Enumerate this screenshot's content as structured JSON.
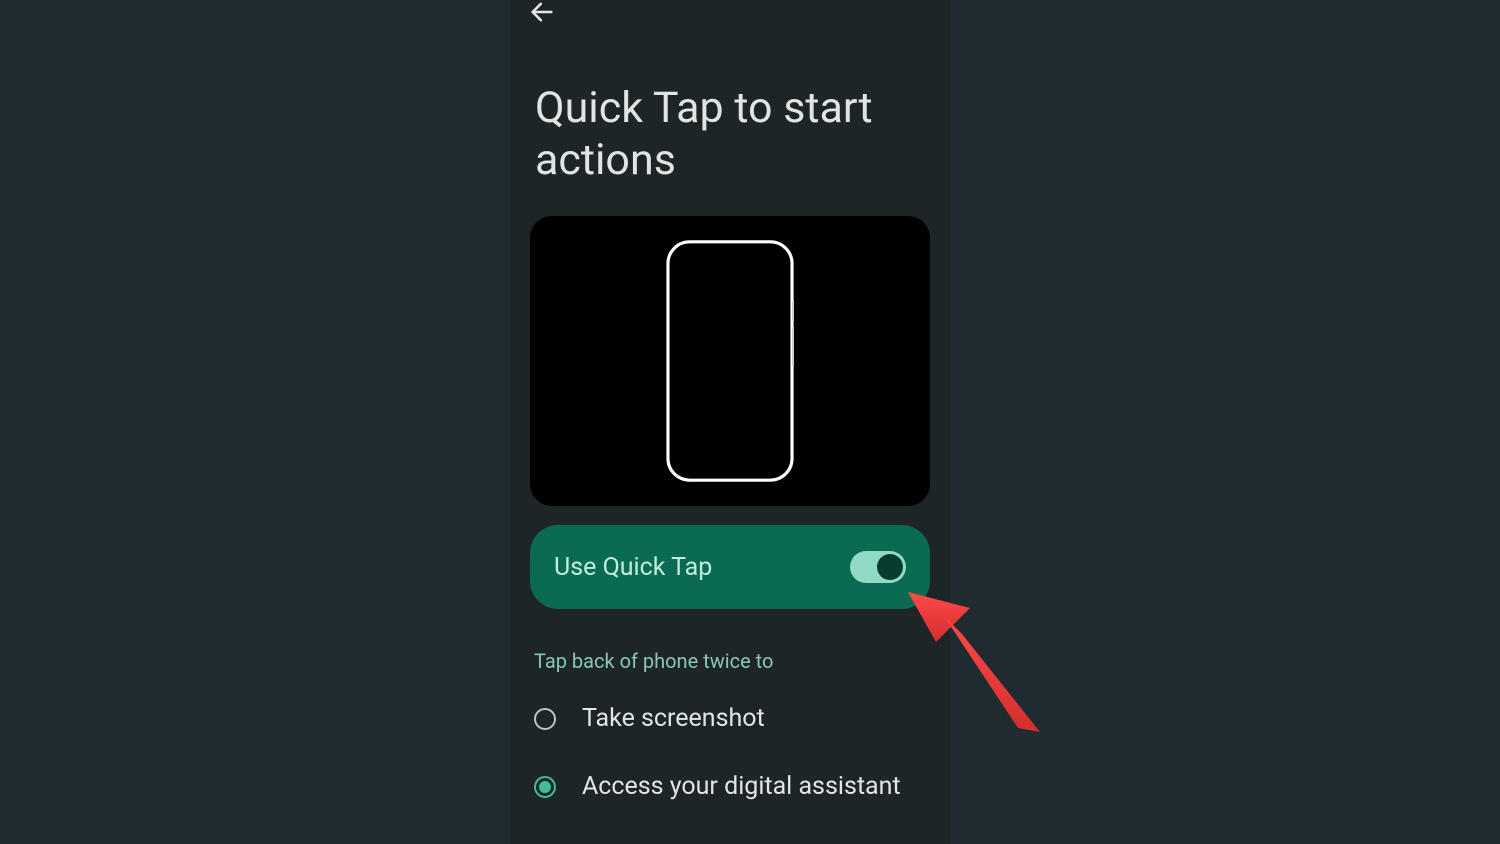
{
  "colors": {
    "accent": "#0a6b52",
    "accent_light": "#86c8b4",
    "toggle_track": "#90d9c4",
    "bg": "#1f2b2e",
    "panel": "#1e2527",
    "card": "#000",
    "text": "#e0e4e3",
    "annot": "#e73c3c"
  },
  "header": {
    "back_icon": "arrow-left"
  },
  "page": {
    "title": "Quick Tap to start actions"
  },
  "toggle": {
    "label": "Use Quick Tap",
    "on": true
  },
  "section": {
    "heading": "Tap back of phone twice to",
    "options": [
      {
        "label": "Take screenshot",
        "selected": false
      },
      {
        "label": "Access your digital assistant",
        "selected": true
      }
    ]
  }
}
